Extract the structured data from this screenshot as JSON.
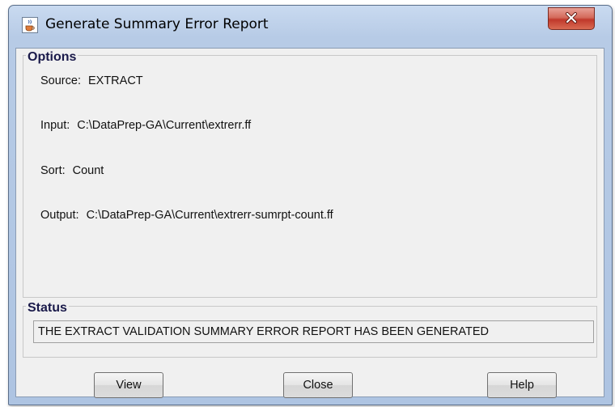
{
  "window": {
    "title": "Generate Summary Error Report",
    "icon": "java-cup-icon",
    "close_icon": "close-icon"
  },
  "options": {
    "title": "Options",
    "rows": [
      {
        "label": "Source:",
        "value": "EXTRACT"
      },
      {
        "label": "Input:",
        "value": "C:\\DataPrep-GA\\Current\\extrerr.ff"
      },
      {
        "label": "Sort:",
        "value": "Count"
      },
      {
        "label": "Output:",
        "value": "C:\\DataPrep-GA\\Current\\extrerr-sumrpt-count.ff"
      }
    ]
  },
  "status": {
    "title": "Status",
    "message": "THE EXTRACT VALIDATION SUMMARY ERROR REPORT HAS BEEN GENERATED"
  },
  "buttons": {
    "view": "View",
    "close": "Close",
    "help": "Help"
  },
  "colors": {
    "title_bar": "#b7cbe6",
    "close_button": "#c0392b",
    "dialog_background": "#f0f0f0",
    "group_title": "#1a1a4a"
  }
}
